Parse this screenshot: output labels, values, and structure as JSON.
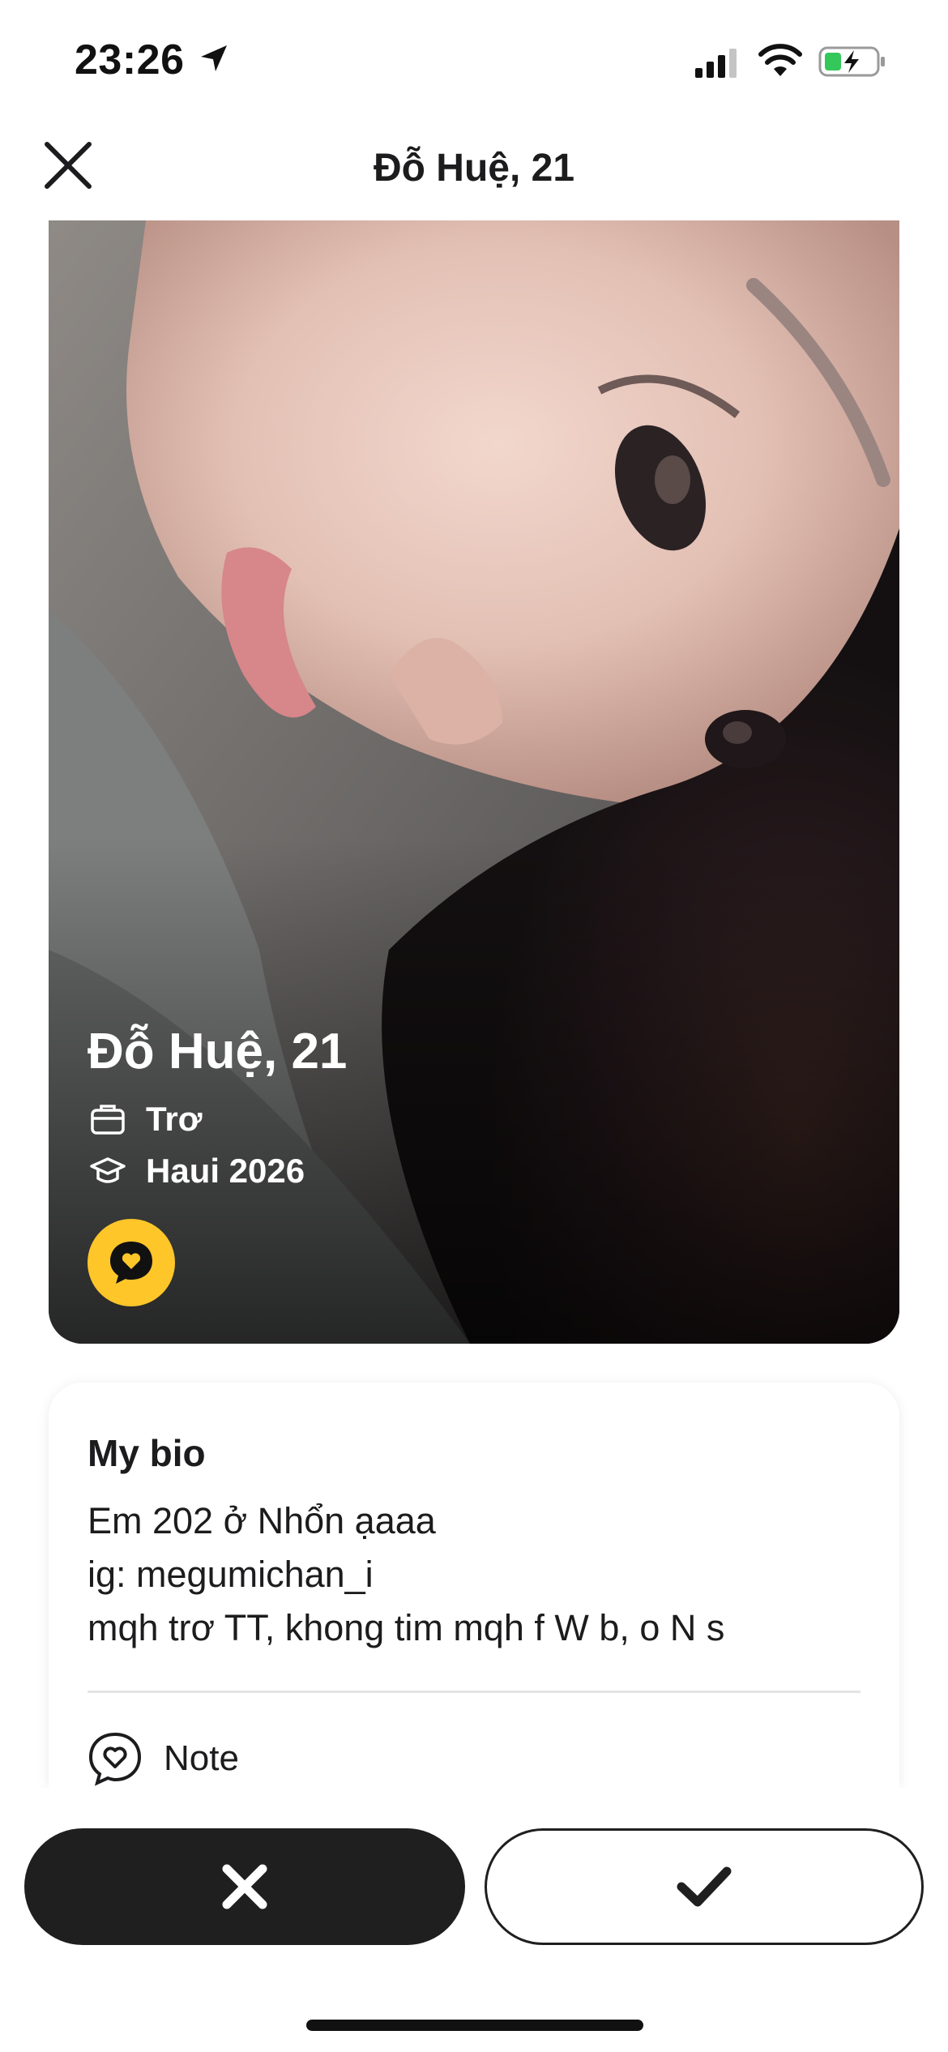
{
  "status_bar": {
    "time": "23:26"
  },
  "header": {
    "title": "Đỗ Huệ, 21"
  },
  "profile": {
    "name_age": "Đỗ Huệ, 21",
    "job": "Trơ",
    "school": "Haui 2026"
  },
  "bio": {
    "title": "My bio",
    "lines": [
      "Em 202 ở Nhổn ạaaa",
      "ig: megumichan_i",
      "mqh trơ TT, khong tim mqh f W b, o N s"
    ]
  },
  "note": {
    "label": "Note"
  },
  "colors": {
    "accent": "#ffc629",
    "dark": "#1f1f1f"
  },
  "icons": {
    "close": "close-icon",
    "job": "briefcase-icon",
    "school": "graduation-cap-icon",
    "chat": "chat-heart-icon",
    "pass": "x-icon",
    "like": "check-icon"
  }
}
